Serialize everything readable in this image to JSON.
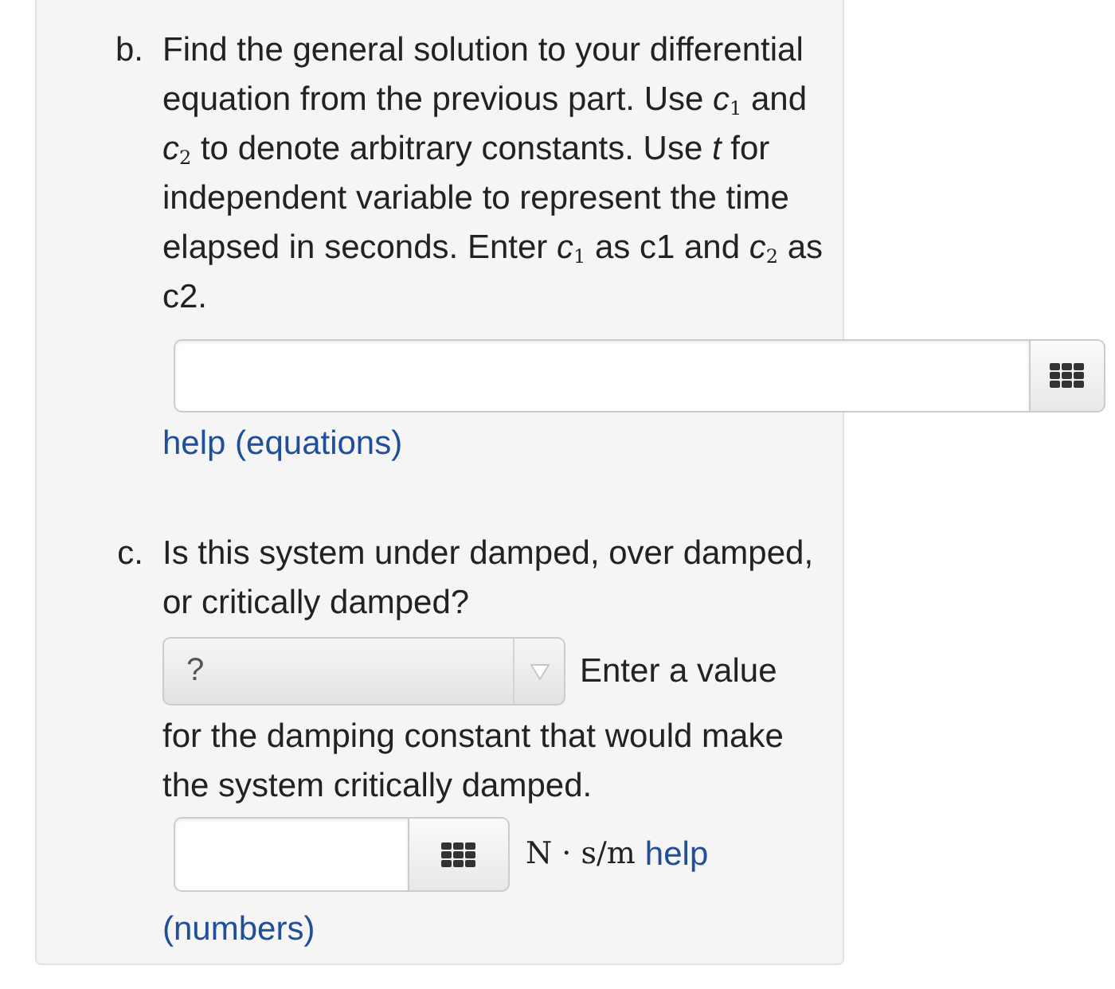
{
  "part_b": {
    "label": "b.",
    "prompt": "Find the general solution to your differential equation from the previous part. Use *c*$_{1}$ and *c*$_{2}$ to denote arbitrary constants. Use *t* for independent variable to represent the time elapsed in seconds. Enter *c*$_{1}$ as c1 and *c*$_{2}$ as c2.",
    "help_link": "help (equations)"
  },
  "part_c": {
    "label": "c.",
    "prompt": "Is this system under damped, over damped, or critically damped?",
    "dropdown": {
      "value": "?"
    },
    "prompt_2": [
      "Enter a value",
      "for the damping constant that would make the system critically damped."
    ],
    "units": "N · s/m",
    "help_link": [
      "help",
      "(numbers)"
    ]
  }
}
